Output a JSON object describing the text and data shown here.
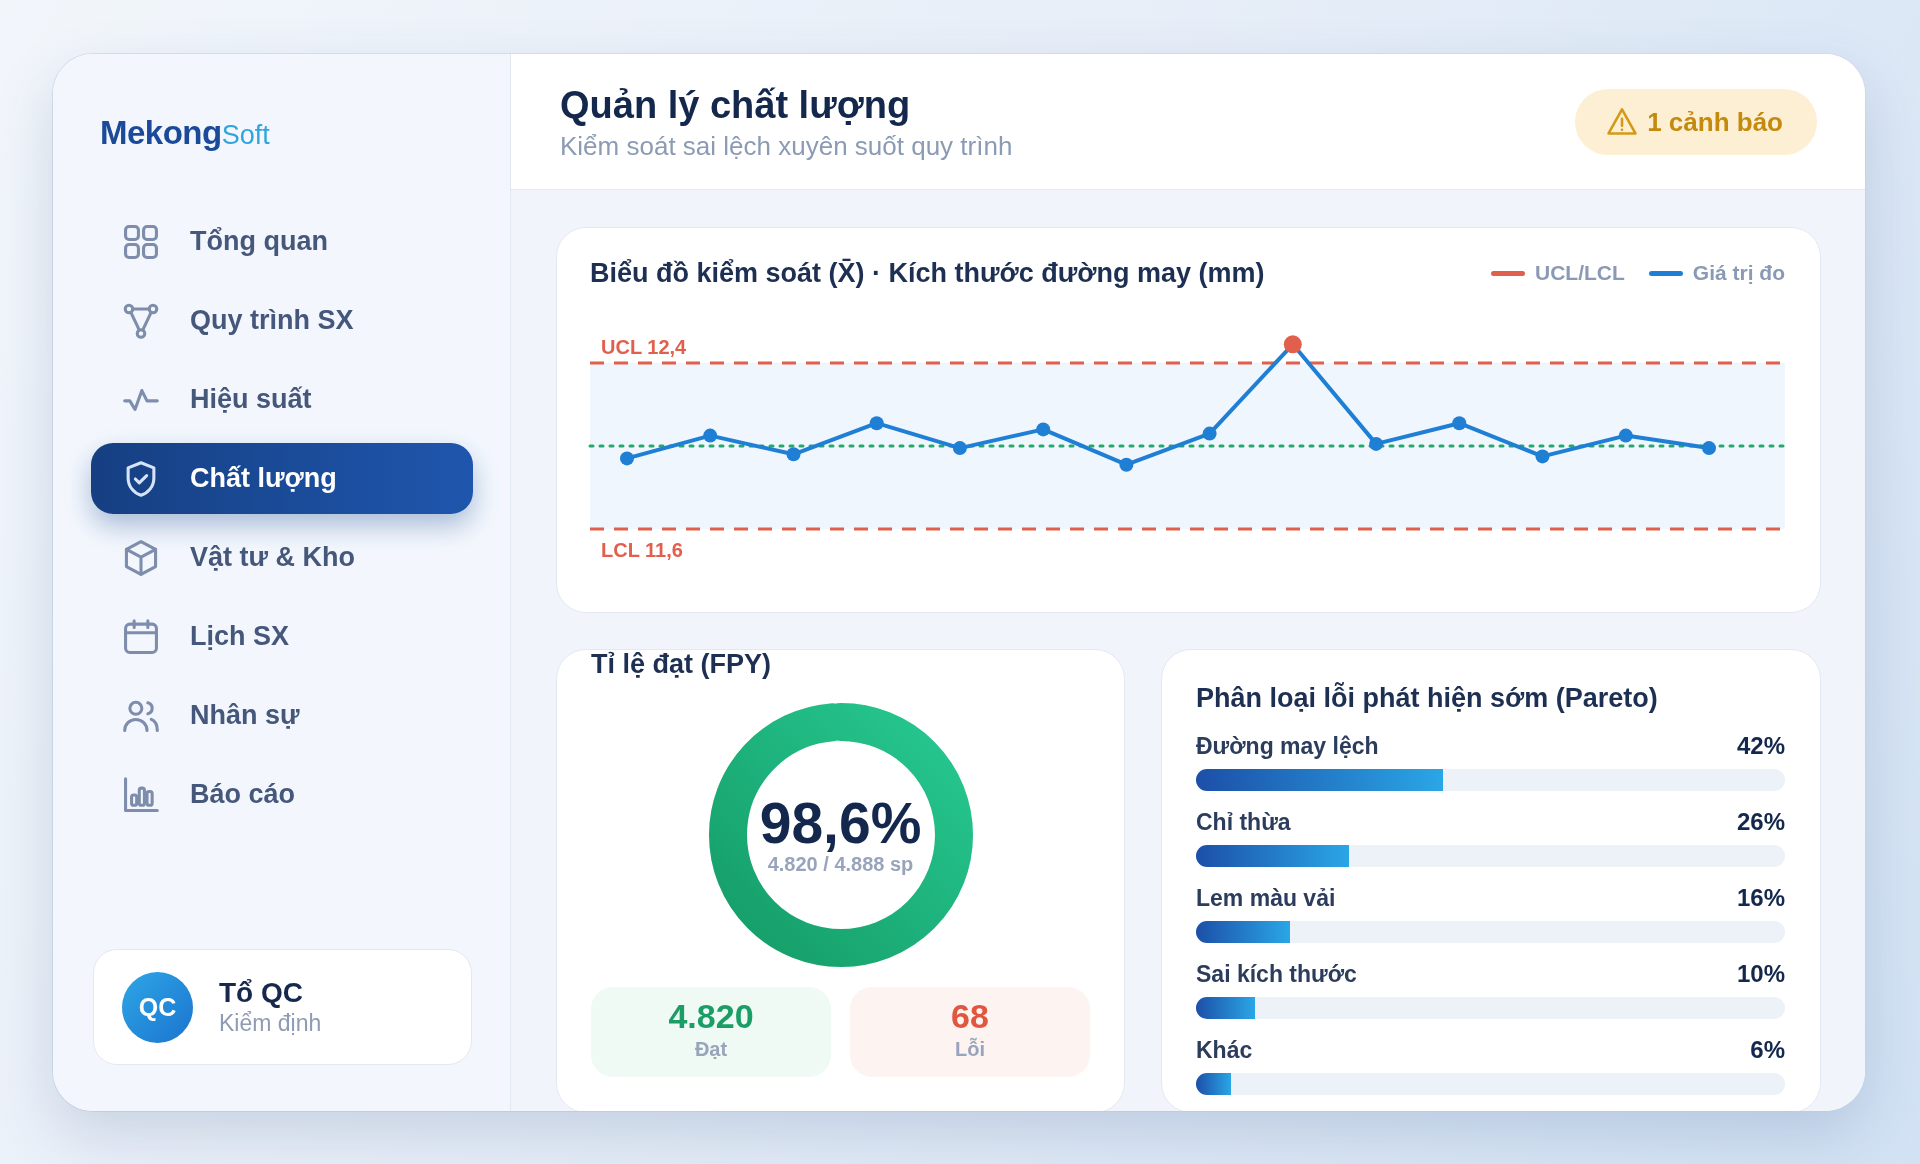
{
  "brand": {
    "logo": "**Mekong**Soft"
  },
  "nav": {
    "items": [
      {
        "label": "Tổng quan",
        "selected": false
      },
      {
        "label": "Quy trình SX",
        "selected": false
      },
      {
        "label": "Hiệu suất",
        "selected": false
      },
      {
        "label": "Chất lượng",
        "selected": true
      },
      {
        "label": "Vật tư & Kho",
        "selected": false
      },
      {
        "label": "Lịch SX",
        "selected": false
      },
      {
        "label": "Nhân sự",
        "selected": false
      },
      {
        "label": "Báo cáo",
        "selected": false
      }
    ]
  },
  "user": {
    "avatar": "QC",
    "name": "Tổ QC",
    "role": "Kiểm định"
  },
  "header": {
    "title": "Quản lý chất lượng",
    "subtitle": "Kiểm soát sai lệch xuyên suốt quy trình",
    "alert": "1 cảnh báo"
  },
  "control_chart": {
    "title": "Biểu đồ kiểm soát (X̄) · Kích thước đường may (mm)",
    "legend": [
      {
        "label": "UCL/LCL",
        "color": "#e0604d"
      },
      {
        "label": "Giá trị đo",
        "color": "#1f7fd4"
      }
    ],
    "limits": [
      {
        "label": "UCL 12,4"
      },
      {
        "label": "LCL 11,6"
      }
    ]
  },
  "fpy": {
    "title": "Tỉ lệ đạt (FPY)",
    "value": "98,6%",
    "caption": "4.820 / 4.888 sp",
    "level": 0.986,
    "stats": [
      {
        "kind": "pass",
        "value": "4.820",
        "label": "Đạt"
      },
      {
        "kind": "fail",
        "value": "68",
        "label": "Lỗi"
      }
    ]
  },
  "pareto": {
    "title": "Phân loại lỗi phát hiện sớm (Pareto)",
    "items": [
      {
        "label": "Đường may lệch",
        "value": "42%",
        "level": 0.42
      },
      {
        "label": "Chỉ thừa",
        "value": "26%",
        "level": 0.26
      },
      {
        "label": "Lem màu vải",
        "value": "16%",
        "level": 0.16
      },
      {
        "label": "Sai kích thước",
        "value": "10%",
        "level": 0.1
      },
      {
        "label": "Khác",
        "value": "6%",
        "level": 0.06
      }
    ]
  }
}
